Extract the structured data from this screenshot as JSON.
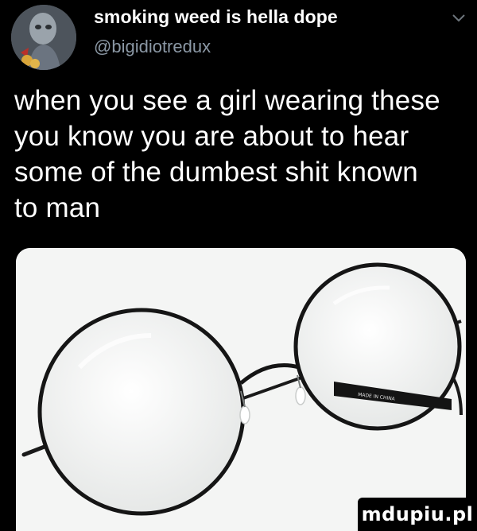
{
  "tweet": {
    "author": {
      "display_name": "smoking weed is hella dope",
      "handle": "@bigidiotredux"
    },
    "menu_icon": "chevron-down-icon",
    "text_lines": [
      "when you see a girl wearing these",
      "you know you are about to hear",
      "some of the dumbest shit known",
      "to man"
    ],
    "media": {
      "description_icon": "round-glasses-image",
      "temple_imprint": "MADE IN CHINA"
    }
  },
  "watermark": {
    "text": "mdupiu.pl"
  },
  "colors": {
    "background": "#000000",
    "text_primary": "#ffffff",
    "text_secondary": "#8b98a5",
    "media_background": "#f4f5f4"
  }
}
